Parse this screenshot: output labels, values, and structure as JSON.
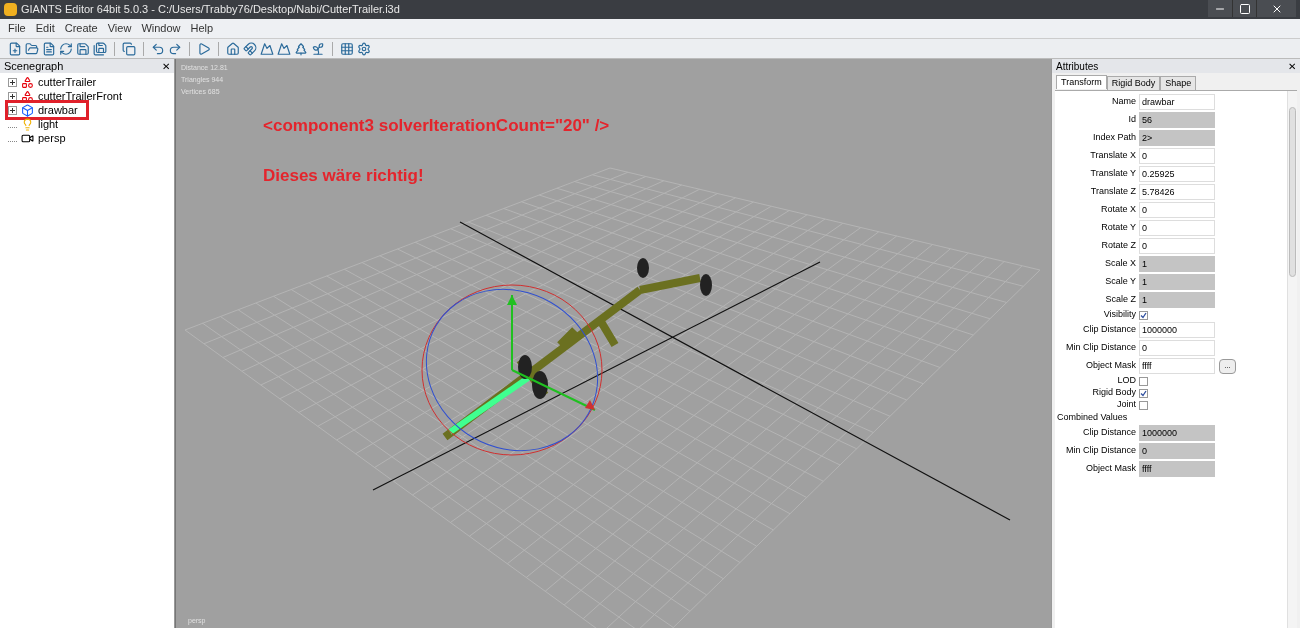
{
  "window": {
    "title": "GIANTS Editor 64bit 5.0.3 - C:/Users/Trabby76/Desktop/Nabi/CutterTrailer.i3d"
  },
  "menu": [
    "File",
    "Edit",
    "Create",
    "View",
    "Window",
    "Help"
  ],
  "scenegraph": {
    "title": "Scenegraph",
    "close": "✕",
    "items": [
      {
        "label": "cutterTrailer",
        "kind": "group",
        "expanded": false,
        "marked": false
      },
      {
        "label": "cutterTrailerFront",
        "kind": "group",
        "expanded": false,
        "marked": false
      },
      {
        "label": "drawbar",
        "kind": "shape",
        "expanded": false,
        "marked": true
      },
      {
        "label": "light",
        "kind": "light",
        "marked": false
      },
      {
        "label": "persp",
        "kind": "camera",
        "marked": false
      }
    ]
  },
  "viewport": {
    "stats": [
      "Distance 12.81",
      "Triangles 944",
      "Vertices 685"
    ],
    "camera": "persp",
    "annotations": [
      "<component3 solverIterationCount=\"20\" />",
      "Dieses wäre richtig!"
    ]
  },
  "attributes": {
    "title": "Attributes",
    "close": "✕",
    "tabs": [
      {
        "label": "Transform",
        "selected": true
      },
      {
        "label": "Rigid Body",
        "selected": false
      },
      {
        "label": "Shape",
        "selected": false
      }
    ],
    "rows": [
      {
        "kind": "field",
        "label": "Name",
        "value": "drawbar",
        "disabled": false
      },
      {
        "kind": "field",
        "label": "Id",
        "value": "56",
        "disabled": true
      },
      {
        "kind": "field",
        "label": "Index Path",
        "value": "2>",
        "disabled": true
      },
      {
        "kind": "field",
        "label": "Translate X",
        "value": "0",
        "disabled": false
      },
      {
        "kind": "field",
        "label": "Translate Y",
        "value": "0.25925",
        "disabled": false
      },
      {
        "kind": "field",
        "label": "Translate Z",
        "value": "5.78426",
        "disabled": false
      },
      {
        "kind": "field",
        "label": "Rotate X",
        "value": "0",
        "disabled": false
      },
      {
        "kind": "field",
        "label": "Rotate Y",
        "value": "0",
        "disabled": false
      },
      {
        "kind": "field",
        "label": "Rotate Z",
        "value": "0",
        "disabled": false
      },
      {
        "kind": "field",
        "label": "Scale X",
        "value": "1",
        "disabled": true
      },
      {
        "kind": "field",
        "label": "Scale Y",
        "value": "1",
        "disabled": true
      },
      {
        "kind": "field",
        "label": "Scale Z",
        "value": "1",
        "disabled": true
      },
      {
        "kind": "checkbox",
        "label": "Visibility",
        "checked": true
      },
      {
        "kind": "field",
        "label": "Clip Distance",
        "value": "1000000",
        "disabled": false
      },
      {
        "kind": "field",
        "label": "Min Clip Distance",
        "value": "0",
        "disabled": false
      },
      {
        "kind": "field",
        "label": "Object Mask",
        "value": "ffff",
        "disabled": false,
        "button": "..."
      },
      {
        "kind": "checkbox",
        "label": "LOD",
        "checked": false
      },
      {
        "kind": "checkbox",
        "label": "Rigid Body",
        "checked": true
      },
      {
        "kind": "checkbox",
        "label": "Joint",
        "checked": false
      },
      {
        "kind": "heading",
        "label": "Combined Values"
      },
      {
        "kind": "field",
        "label": "Clip Distance",
        "value": "1000000",
        "disabled": true
      },
      {
        "kind": "field",
        "label": "Min Clip Distance",
        "value": "0",
        "disabled": true
      },
      {
        "kind": "field",
        "label": "Object Mask",
        "value": "ffff",
        "disabled": true
      }
    ]
  }
}
